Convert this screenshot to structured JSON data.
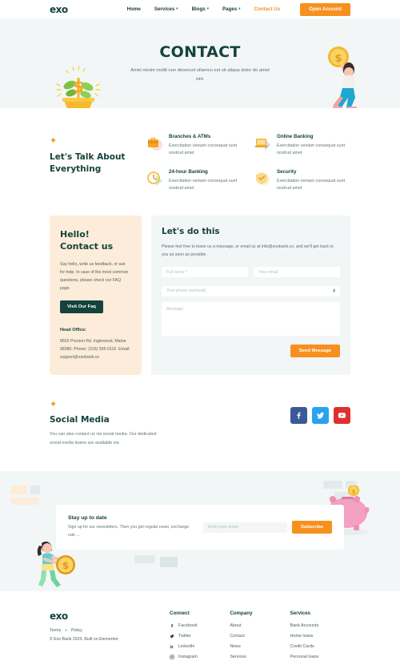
{
  "nav": {
    "logo": "exo",
    "items": [
      {
        "label": "Home",
        "caret": false,
        "active": false
      },
      {
        "label": "Services",
        "caret": true,
        "active": false
      },
      {
        "label": "Blogs",
        "caret": true,
        "active": false
      },
      {
        "label": "Pages",
        "caret": true,
        "active": false
      },
      {
        "label": "Contact Us",
        "caret": false,
        "active": true
      }
    ],
    "cta": "Open Account",
    "caret_glyph": "▾"
  },
  "hero": {
    "title": "CONTACT",
    "subtitle": "Amet minim mollit non deserunt ullamco est sit aliqua dolor do amet sint.",
    "art_left": "money-plant-illustration",
    "art_right": "person-climbing-steps-with-coin-illustration"
  },
  "features": {
    "star": "✦",
    "heading": "Let's Talk About Everything",
    "items": [
      {
        "title": "Branches & ATMs",
        "desc": "Exercitation veniam consequat sunt nostrud amet",
        "icon": "briefcase-icon",
        "blob": "#fbdce8"
      },
      {
        "title": "Online Banking",
        "desc": "Exercitation veniam consequat sunt nostrud amet",
        "icon": "laptop-icon",
        "blob": "#dcd9f5"
      },
      {
        "title": "24-hour Banking",
        "desc": "Exercitation veniam consequat sunt nostrud amet",
        "icon": "clock-icon",
        "blob": "#cdecd3"
      },
      {
        "title": "Security",
        "desc": "Exercitation veniam consequat sunt nostrud amet",
        "icon": "shield-icon",
        "blob": "#fdecd9"
      }
    ]
  },
  "contact": {
    "hello_title_line1": "Hello!",
    "hello_title_line2": "Contact us",
    "hello_body": "Say hello, write us feedback, or ask for help. In case of the most common questions, please check our FAQ page.",
    "faq_button": "Visit Our Faq",
    "head_office_label": "Head Office:",
    "head_office_address": "8502 Preston Rd. Inglewood, Maine 98380. Phone: (316) 555-0116. Email: support@exobank.co",
    "form_title": "Let's do this",
    "form_intro": "Please feel free to leave us a message, or email us at info@exobank.co, and we'll get back to you as soon as possible.",
    "placeholder_name": "Full name *",
    "placeholder_email": "Your email",
    "placeholder_phone": "Your phone (optional)",
    "placeholder_message": "Message",
    "phone_icon": "▮",
    "send_button": "Send Message"
  },
  "social": {
    "star": "✦",
    "title": "Social Media",
    "body": "You can also contact us via social media. Our dedicated social media teams are available via",
    "icons": [
      {
        "name": "facebook-icon",
        "color": "#3b5998"
      },
      {
        "name": "twitter-icon",
        "color": "#2aa3ef"
      },
      {
        "name": "youtube-icon",
        "color": "#e02f2f"
      }
    ]
  },
  "newsletter": {
    "title": "Stay up to date",
    "body": "Sign up for our newsletters. Then you get regular news, exchange rate ...",
    "placeholder_email": "Enter your email",
    "button": "Subscribe",
    "art_left": "running-woman-with-coin-illustration",
    "art_right": "piggy-bank-illustration"
  },
  "footer": {
    "logo": "exo",
    "terms": "Terms",
    "separator": "»",
    "policy": "Policy",
    "copyright": "© Exo Bank 2020. Built on Elementor",
    "columns": [
      {
        "title": "Connect",
        "items": [
          {
            "label": "Facebook",
            "icon": "facebook-icon"
          },
          {
            "label": "Twitter",
            "icon": "twitter-icon"
          },
          {
            "label": "LinkedIn",
            "icon": "linkedin-icon"
          },
          {
            "label": "Instagram",
            "icon": "instagram-icon"
          }
        ]
      },
      {
        "title": "Company",
        "items": [
          {
            "label": "About"
          },
          {
            "label": "Contact"
          },
          {
            "label": "News"
          },
          {
            "label": "Services"
          }
        ]
      },
      {
        "title": "Services",
        "items": [
          {
            "label": "Bank Accounts"
          },
          {
            "label": "Home loans"
          },
          {
            "label": "Credit Cards"
          },
          {
            "label": "Personal loans"
          }
        ]
      }
    ]
  },
  "colors": {
    "accent_orange": "#f7901e",
    "brand_dark": "#14433c",
    "hero_bg": "#f2f6f6",
    "card_peach": "#fdecd9"
  }
}
